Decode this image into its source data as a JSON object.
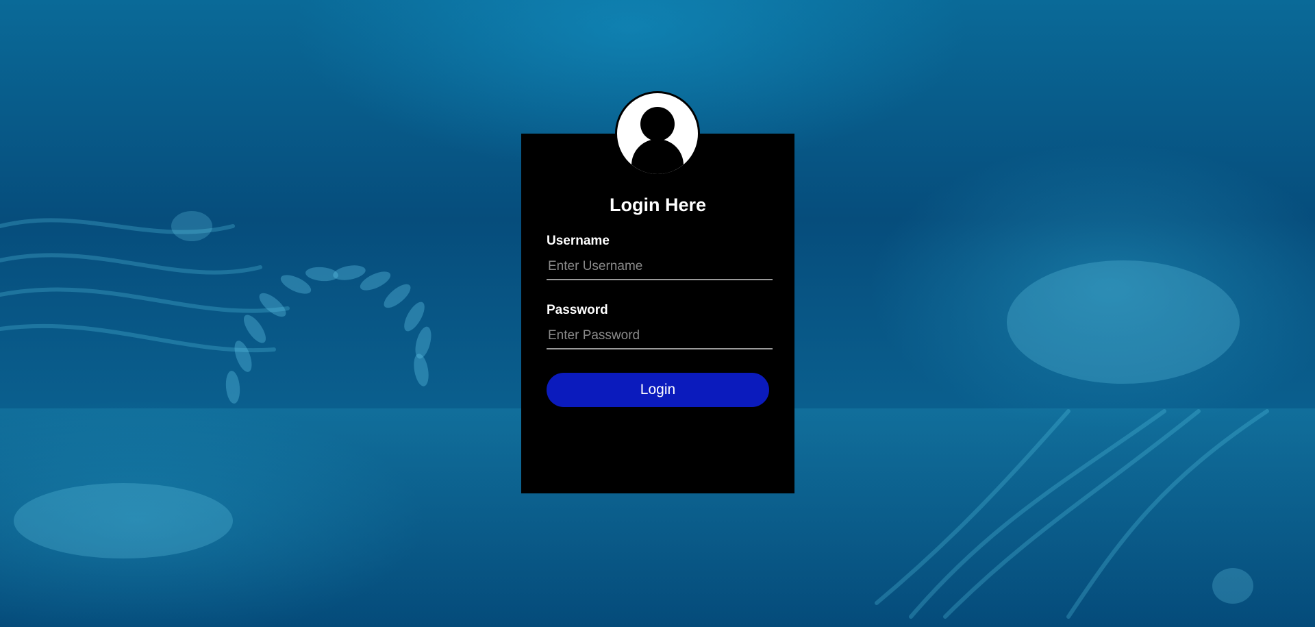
{
  "login": {
    "title": "Login Here",
    "username_label": "Username",
    "username_placeholder": "Enter Username",
    "username_value": "",
    "password_label": "Password",
    "password_placeholder": "Enter Password",
    "password_value": "",
    "submit_label": "Login"
  },
  "icons": {
    "avatar": "user-avatar-icon"
  },
  "colors": {
    "card_background": "#000000",
    "button_background": "#0b1bbd",
    "text": "#ffffff",
    "placeholder": "#8a8a8a",
    "underline": "#9a9a9a",
    "page_background": "#064d7c"
  }
}
